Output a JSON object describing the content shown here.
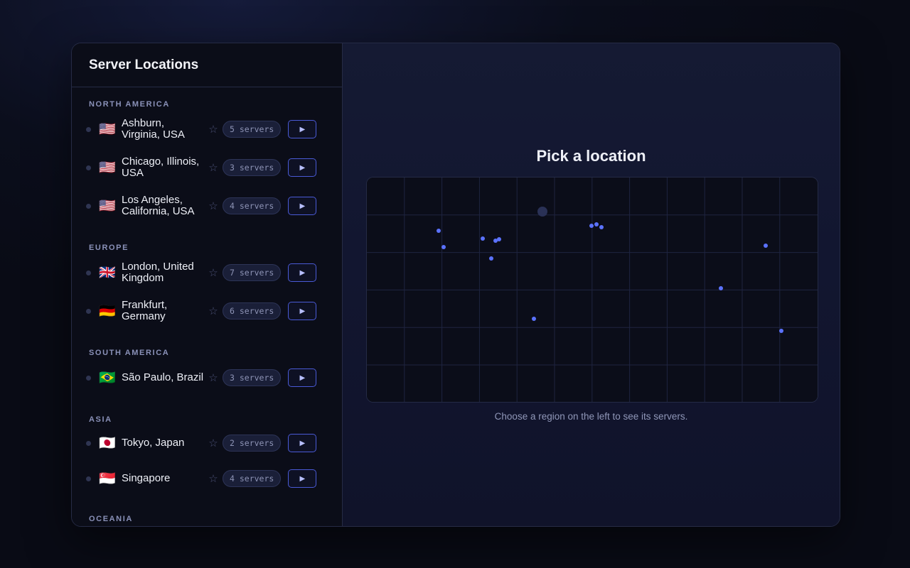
{
  "sidebar": {
    "title": "Server Locations",
    "regions": [
      {
        "name": "NORTH AMERICA",
        "locations": [
          {
            "flag": "🇺🇸",
            "name": "Ashburn, Virginia, USA",
            "servers": "5 servers"
          },
          {
            "flag": "🇺🇸",
            "name": "Chicago, Illinois, USA",
            "servers": "3 servers"
          },
          {
            "flag": "🇺🇸",
            "name": "Los Angeles, California, USA",
            "servers": "4 servers"
          }
        ]
      },
      {
        "name": "EUROPE",
        "locations": [
          {
            "flag": "🇬🇧",
            "name": "London, United Kingdom",
            "servers": "7 servers"
          },
          {
            "flag": "🇩🇪",
            "name": "Frankfurt, Germany",
            "servers": "6 servers"
          }
        ]
      },
      {
        "name": "SOUTH AMERICA",
        "locations": [
          {
            "flag": "🇧🇷",
            "name": "São Paulo, Brazil",
            "servers": "3 servers"
          }
        ]
      },
      {
        "name": "ASIA",
        "locations": [
          {
            "flag": "🇯🇵",
            "name": "Tokyo, Japan",
            "servers": "2 servers"
          },
          {
            "flag": "🇸🇬",
            "name": "Singapore",
            "servers": "4 servers"
          }
        ]
      },
      {
        "name": "OCEANIA",
        "locations": []
      }
    ],
    "star_icon": "star-icon",
    "play_icon": "play-icon"
  },
  "main": {
    "title": "Pick a location",
    "hint": "Choose a region on the left to see its servers.",
    "map_colors": {
      "point": "#5b72ff",
      "grid": "#1f2440",
      "background": "#0b0d19",
      "highlight": "#2a3156"
    }
  }
}
